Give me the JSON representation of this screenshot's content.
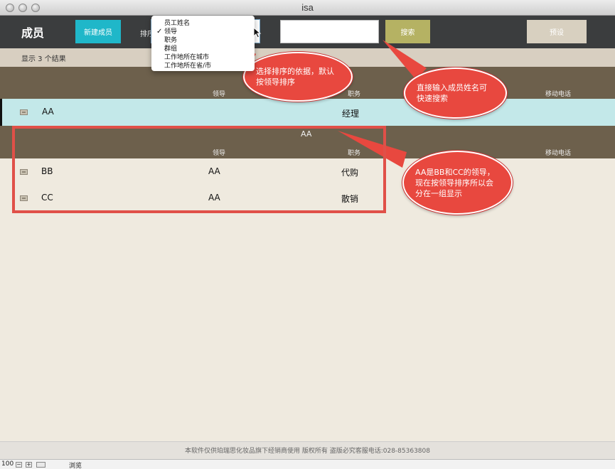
{
  "window": {
    "title": "isa"
  },
  "header": {
    "app_title": "成员",
    "new_button": "新建成员",
    "sort_label": "排序",
    "search_button": "搜索",
    "preset_button": "预设"
  },
  "sort_menu": {
    "selected_index": 1,
    "options": [
      "员工姓名",
      "领导",
      "职务",
      "群组",
      "工作地所在城市",
      "工作地所在省/市"
    ]
  },
  "results": {
    "summary": "显示 3 个结果"
  },
  "columns": {
    "leader": "领导",
    "position": "职务",
    "mobile": "移动电话"
  },
  "leader_row": {
    "name": "AA",
    "position": "经理"
  },
  "group": {
    "title": "AA",
    "rows": [
      {
        "name": "BB",
        "leader": "AA",
        "position": "代购"
      },
      {
        "name": "CC",
        "leader": "AA",
        "position": "散销"
      }
    ]
  },
  "footer": {
    "text": "本软件仅供珀瑞思化妆品旗下经销商使用 版权所有 盗版必究客服电话:028-85363808"
  },
  "statusbar": {
    "zoom": "100",
    "mode": "浏览"
  },
  "annotations": {
    "sort_note": "选择排序的依据，默认按领导排序",
    "search_note": "直接输入成员姓名可快速搜索",
    "group_note": "AA是BB和CC的领导，现在按领导排序所以会分在一组显示"
  },
  "colors": {
    "header_bg": "#3b3d3e",
    "accent_new": "#1fb7c9",
    "accent_search": "#b5b263",
    "column_header_bg": "#6d604c",
    "selected_row_bg": "#c3e8e9",
    "annotation_red": "#e8483f"
  }
}
